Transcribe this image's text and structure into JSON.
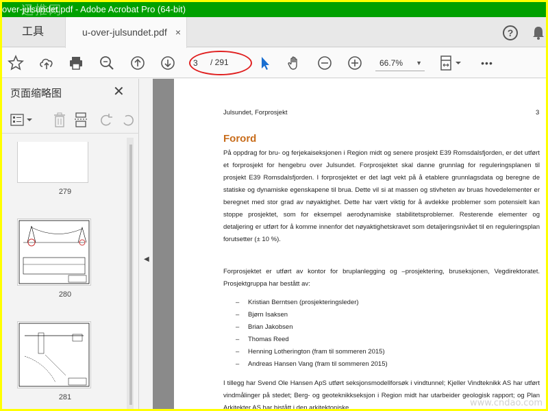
{
  "window": {
    "title": "over-julsundet.pdf - Adobe Acrobat Pro (64-bit)",
    "logo_text": "迅推网"
  },
  "tabs": {
    "tools_label": "工具",
    "doc_label": "u-over-julsundet.pdf",
    "close_glyph": "×"
  },
  "header_icons": {
    "help": "?"
  },
  "toolbar": {
    "icons": [
      "star-icon",
      "cloud-upload-icon",
      "print-icon",
      "zoom-search-icon",
      "page-up-icon",
      "page-down-icon",
      "select-cursor-icon",
      "hand-tool-icon",
      "zoom-out-icon",
      "zoom-in-icon",
      "fit-page-icon",
      "more-icon"
    ],
    "current_page": "3",
    "total_pages": "/ 291",
    "zoom": "66.7%",
    "more": "•••"
  },
  "sidebar": {
    "title": "页面缩略图",
    "close_glyph": "✕",
    "thumbnails": [
      {
        "page": "279"
      },
      {
        "page": "280"
      },
      {
        "page": "281"
      }
    ]
  },
  "document": {
    "running_head": "Julsundet, Forprosjekt",
    "page_number": "3",
    "heading": "Forord",
    "para1": "På oppdrag for bru- og ferjekaiseksjonen i Region midt og senere prosjekt E39 Romsdalsfjorden, er det utført et forprosjekt for hengebru over Julsundet. Forprosjektet skal danne grunnlag for reguleringsplanen til prosjekt E39 Romsdalsfjorden. I forprosjektet er det lagt vekt på å etablere grunnlagsdata og beregne de statiske og dynamiske egenskapene til brua. Dette vil si at massen og stivheten av bruas hovedelementer er beregnet med stor grad av nøyaktighet. Dette har vært viktig for å avdekke problemer som potensielt kan stoppe prosjektet, som for eksempel aerodynamiske stabilitetsproblemer. Resterende elementer og detaljering er utført for å komme innenfor det nøyaktighetskravet som detaljeringsnivået til en reguleringsplan forutsetter (± 10 %).",
    "para2": "Forprosjektet er utført av kontor for bruplanlegging og –prosjektering, bruseksjonen, Vegdirektoratet. Prosjektgruppa har bestått av:",
    "members": [
      "Kristian Berntsen (prosjekteringsleder)",
      "Bjørn Isaksen",
      "Brian Jakobsen",
      "Thomas Reed",
      "Henning Lotherington (fram til sommeren 2015)",
      "Andreas Hansen Vang (fram til sommeren 2015)"
    ],
    "list_dash": "–",
    "para3": "I tillegg har Svend Ole Hansen ApS utført seksjonsmodellforsøk i vindtunnel; Kjeller Vindteknikk AS har utført vindmålinger på stedet; Berg- og geoteknikkseksjon i Region midt har utarbeider geologisk rapport; og Plan Arkitekter AS har bistått i den arkitektoniske"
  },
  "watermark": "www.cndao.com"
}
